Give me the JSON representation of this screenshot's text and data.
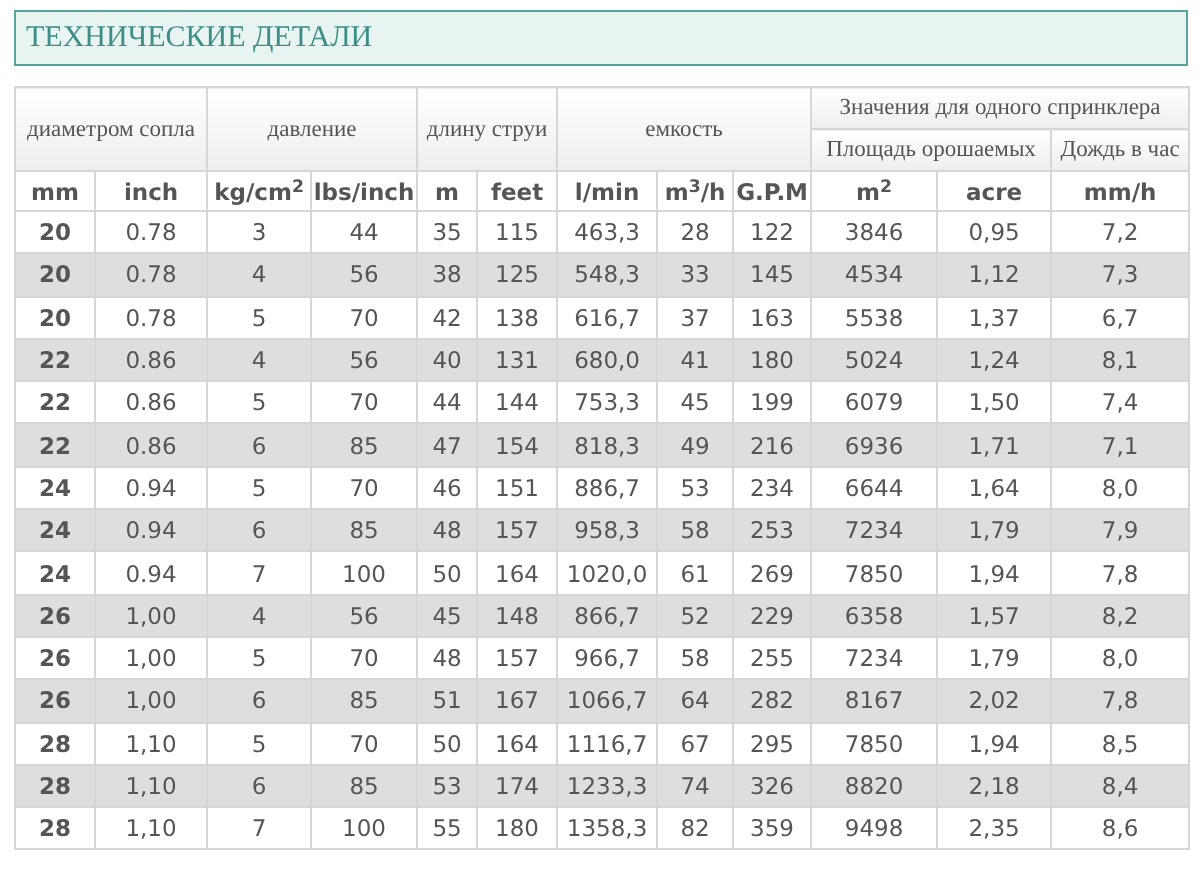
{
  "title": "ТЕХНИЧЕСКИЕ ДЕТАЛИ",
  "table": {
    "groups": [
      {
        "label": "диаметром сопла",
        "units": [
          "mm",
          "inch"
        ]
      },
      {
        "label": "давление",
        "units": [
          "kg/cm$^{2}$",
          "lbs/inch"
        ]
      },
      {
        "label": "длину струи",
        "units": [
          "m",
          "feet"
        ]
      },
      {
        "label": "емкость",
        "units": [
          "l/min",
          "m$^{3}$/h",
          "G.P.M"
        ]
      },
      {
        "label": "Значения для одного спринклера",
        "subgroups": [
          {
            "label": "Площадь орошаемых",
            "units": [
              "m$^{2}$",
              "acre"
            ]
          },
          {
            "label": "Дождь в час",
            "units": [
              "mm/h"
            ]
          }
        ]
      }
    ],
    "rows": [
      [
        "20",
        "0.78",
        "3",
        "44",
        "35",
        "115",
        "463,3",
        "28",
        "122",
        "3846",
        "0,95",
        "7,2"
      ],
      [
        "20",
        "0.78",
        "4",
        "56",
        "38",
        "125",
        "548,3",
        "33",
        "145",
        "4534",
        "1,12",
        "7,3"
      ],
      [
        "20",
        "0.78",
        "5",
        "70",
        "42",
        "138",
        "616,7",
        "37",
        "163",
        "5538",
        "1,37",
        "6,7"
      ],
      [
        "22",
        "0.86",
        "4",
        "56",
        "40",
        "131",
        "680,0",
        "41",
        "180",
        "5024",
        "1,24",
        "8,1"
      ],
      [
        "22",
        "0.86",
        "5",
        "70",
        "44",
        "144",
        "753,3",
        "45",
        "199",
        "6079",
        "1,50",
        "7,4"
      ],
      [
        "22",
        "0.86",
        "6",
        "85",
        "47",
        "154",
        "818,3",
        "49",
        "216",
        "6936",
        "1,71",
        "7,1"
      ],
      [
        "24",
        "0.94",
        "5",
        "70",
        "46",
        "151",
        "886,7",
        "53",
        "234",
        "6644",
        "1,64",
        "8,0"
      ],
      [
        "24",
        "0.94",
        "6",
        "85",
        "48",
        "157",
        "958,3",
        "58",
        "253",
        "7234",
        "1,79",
        "7,9"
      ],
      [
        "24",
        "0.94",
        "7",
        "100",
        "50",
        "164",
        "1020,0",
        "61",
        "269",
        "7850",
        "1,94",
        "7,8"
      ],
      [
        "26",
        "1,00",
        "4",
        "56",
        "45",
        "148",
        "866,7",
        "52",
        "229",
        "6358",
        "1,57",
        "8,2"
      ],
      [
        "26",
        "1,00",
        "5",
        "70",
        "48",
        "157",
        "966,7",
        "58",
        "255",
        "7234",
        "1,79",
        "8,0"
      ],
      [
        "26",
        "1,00",
        "6",
        "85",
        "51",
        "167",
        "1066,7",
        "64",
        "282",
        "8167",
        "2,02",
        "7,8"
      ],
      [
        "28",
        "1,10",
        "5",
        "70",
        "50",
        "164",
        "1116,7",
        "67",
        "295",
        "7850",
        "1,94",
        "8,5"
      ],
      [
        "28",
        "1,10",
        "6",
        "85",
        "53",
        "174",
        "1233,3",
        "74",
        "326",
        "8820",
        "2,18",
        "8,4"
      ],
      [
        "28",
        "1,10",
        "7",
        "100",
        "55",
        "180",
        "1358,3",
        "82",
        "359",
        "9498",
        "2,35",
        "8,6"
      ]
    ]
  }
}
